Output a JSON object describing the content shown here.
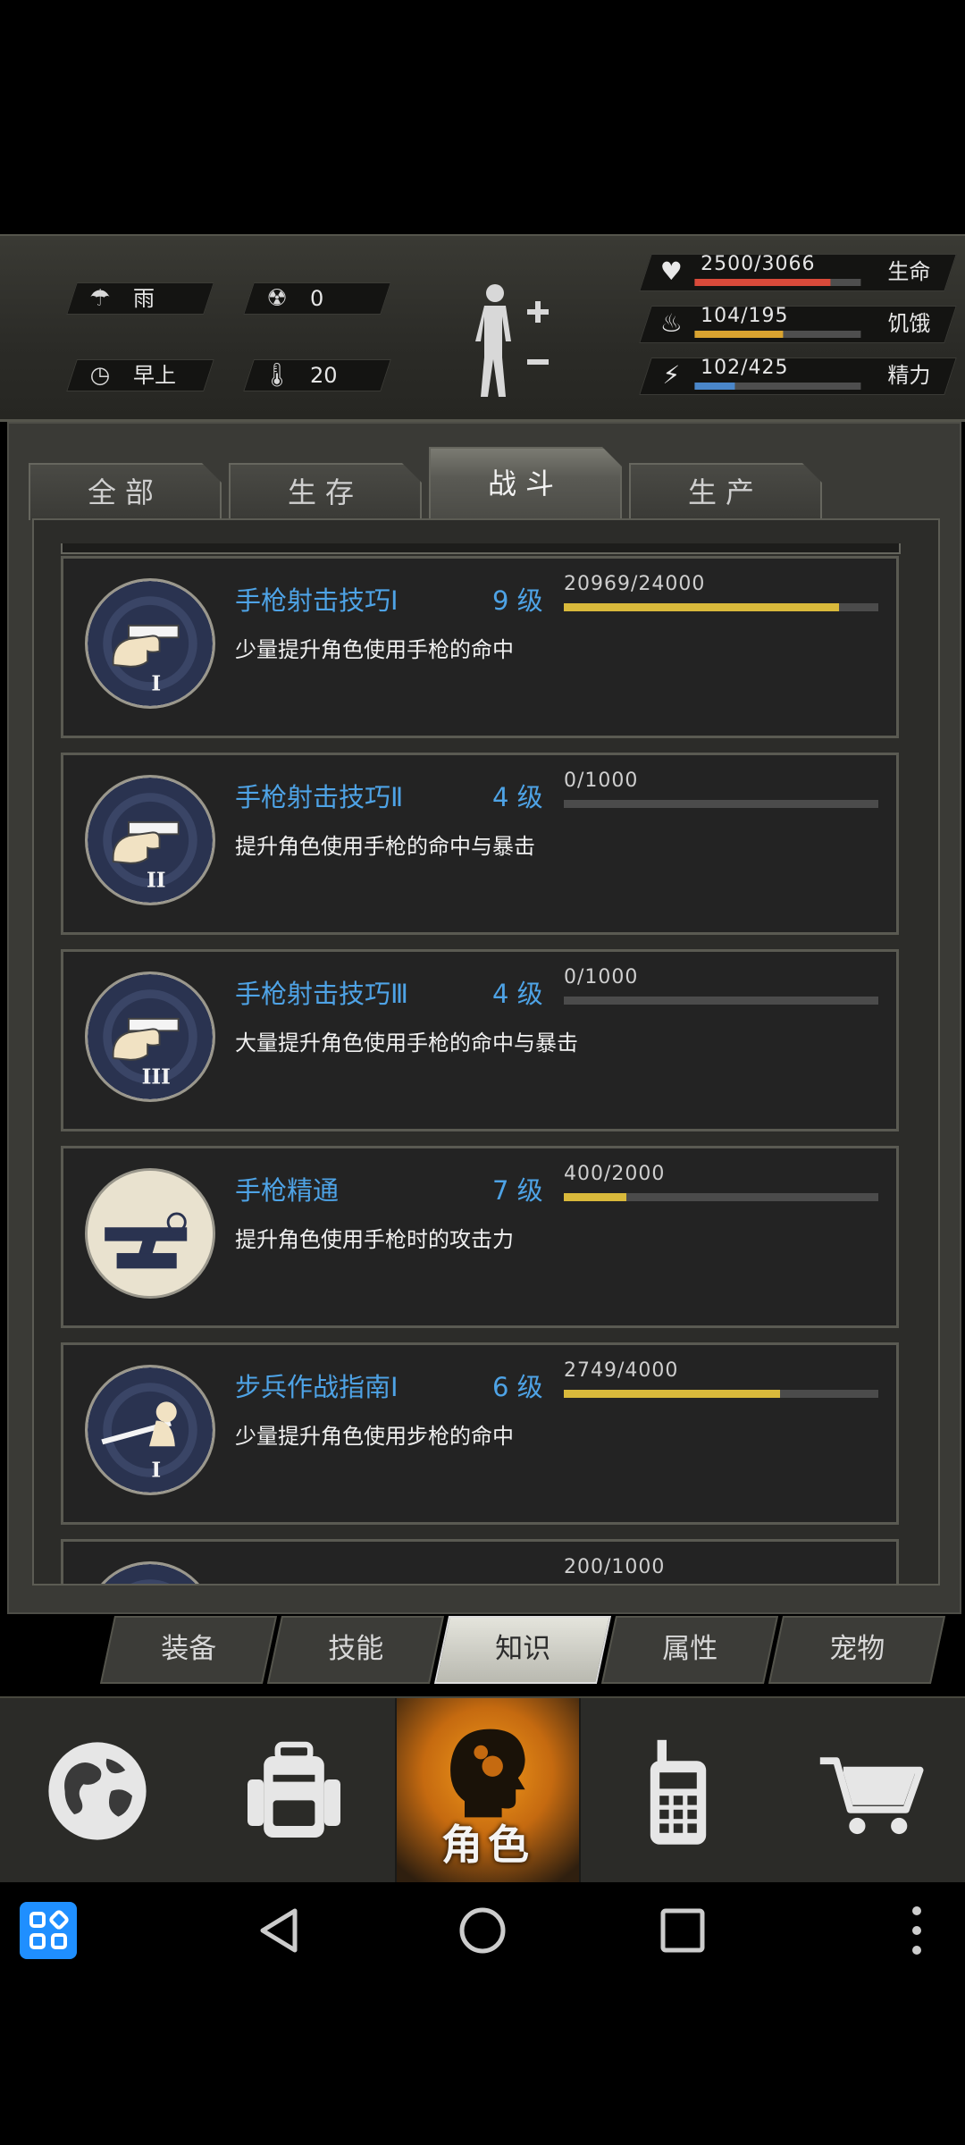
{
  "env": {
    "weather": "雨",
    "radiation": "0",
    "time_of_day": "早上",
    "temperature": "20"
  },
  "stats": [
    {
      "id": "life",
      "value": "2500/3066",
      "name": "生命",
      "fill": 0.815,
      "color": "#d94a3a"
    },
    {
      "id": "hunger",
      "value": "104/195",
      "name": "饥饿",
      "fill": 0.533,
      "color": "#d9a330"
    },
    {
      "id": "energy",
      "value": "102/425",
      "name": "精力",
      "fill": 0.24,
      "color": "#4a86c9"
    }
  ],
  "category_tabs": [
    "全部",
    "生存",
    "战斗",
    "生产"
  ],
  "active_category": 2,
  "skills": [
    {
      "name": "手枪射击技巧Ⅰ",
      "level": "9 级",
      "xp": "20969/24000",
      "fill": 0.874,
      "desc": "少量提升角色使用手枪的命中",
      "icon": "pistol-hand-1-icon"
    },
    {
      "name": "手枪射击技巧Ⅱ",
      "level": "4 级",
      "xp": "0/1000",
      "fill": 0,
      "desc": "提升角色使用手枪的命中与暴击",
      "icon": "pistol-hand-2-icon"
    },
    {
      "name": "手枪射击技巧Ⅲ",
      "level": "4 级",
      "xp": "0/1000",
      "fill": 0,
      "desc": "大量提升角色使用手枪的命中与暴击",
      "icon": "pistol-hand-3-icon"
    },
    {
      "name": "手枪精通",
      "level": "7 级",
      "xp": "400/2000",
      "fill": 0.2,
      "desc": "提升角色使用手枪时的攻击力",
      "icon": "pistol-mastery-icon"
    },
    {
      "name": "步兵作战指南Ⅰ",
      "level": "6 级",
      "xp": "2749/4000",
      "fill": 0.687,
      "desc": "少量提升角色使用步枪的命中",
      "icon": "rifle-soldier-icon"
    },
    {
      "name": "",
      "level": "",
      "xp": "200/1000",
      "fill": 0.2,
      "desc": "",
      "icon": "skill-partial-icon"
    }
  ],
  "sub_tabs": [
    "装备",
    "技能",
    "知识",
    "属性",
    "宠物"
  ],
  "active_sub_tab": 2,
  "bottom_nav": {
    "role_label": "角色",
    "items": [
      "globe-icon",
      "backpack-icon",
      "character-icon",
      "radio-icon",
      "cart-icon"
    ]
  }
}
